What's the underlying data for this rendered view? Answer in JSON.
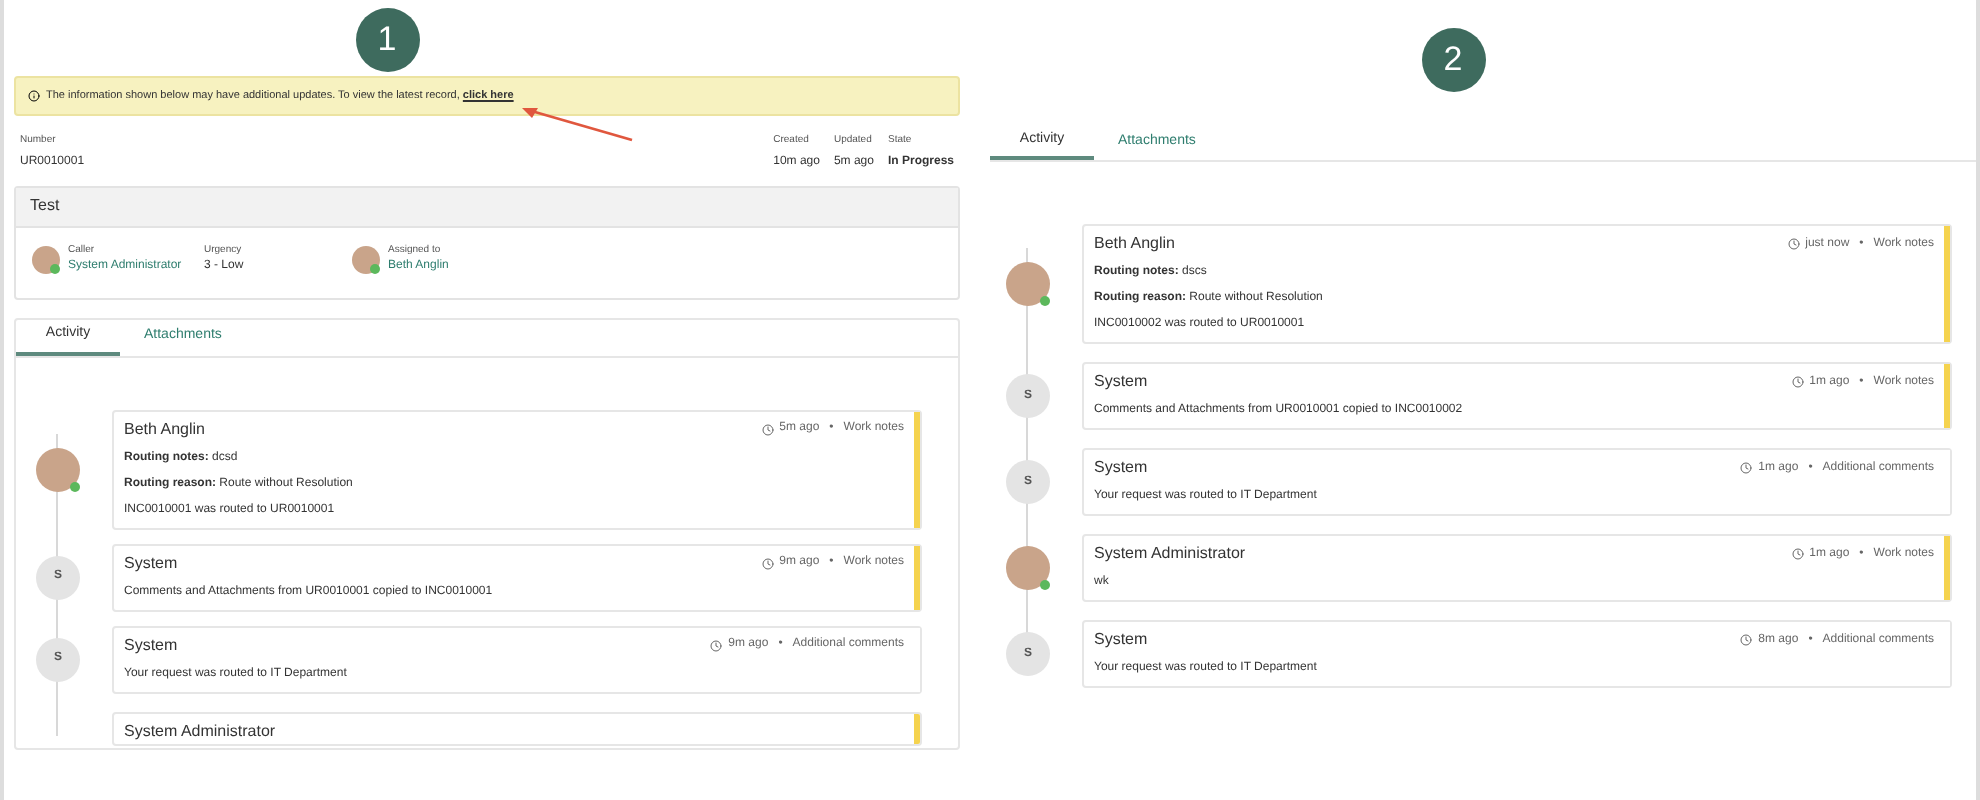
{
  "panels": [
    {
      "badge": "1",
      "banner": {
        "text": "The information shown below may have additional updates. To view the latest record,",
        "link": "click here"
      },
      "record": {
        "number_label": "Number",
        "number": "UR0010001",
        "meta": [
          {
            "label": "Created",
            "value": "10m ago",
            "bold": false
          },
          {
            "label": "Updated",
            "value": "5m ago",
            "bold": false
          },
          {
            "label": "State",
            "value": "In Progress",
            "bold": true
          }
        ]
      },
      "summary": {
        "title": "Test",
        "fields": [
          {
            "label": "Caller",
            "value": "System Administrator",
            "kind": "person"
          },
          {
            "label": "Urgency",
            "value": "3 - Low",
            "kind": "plain"
          },
          {
            "label": "Assigned to",
            "value": "Beth Anglin",
            "kind": "person"
          }
        ]
      },
      "tabs": [
        {
          "label": "Activity",
          "selected": true
        },
        {
          "label": "Attachments",
          "selected": false
        }
      ],
      "entries": [
        {
          "author": "Beth Anglin",
          "kind": "person",
          "time": "5m ago",
          "separator": "•",
          "type": "Work notes",
          "highlighted": true,
          "lines": [
            {
              "label": "Routing notes:",
              "text": "dcsd"
            },
            {
              "label": "Routing reason:",
              "text": "Route without Resolution"
            },
            {
              "text": "INC0010001 was routed to UR0010001"
            }
          ]
        },
        {
          "author": "System",
          "kind": "system",
          "initial": "S",
          "time": "9m ago",
          "separator": "•",
          "type": "Work notes",
          "highlighted": true,
          "lines": [
            {
              "text": "Comments and Attachments from UR0010001 copied to INC0010001"
            }
          ]
        },
        {
          "author": "System",
          "kind": "system",
          "initial": "S",
          "time": "9m ago",
          "separator": "•",
          "type": "Additional comments",
          "highlighted": false,
          "lines": [
            {
              "text": "Your request was routed to IT Department"
            }
          ]
        },
        {
          "author": "System Administrator",
          "highlighted": true
        }
      ]
    },
    {
      "badge": "2",
      "tabs": [
        {
          "label": "Activity",
          "selected": true
        },
        {
          "label": "Attachments",
          "selected": false
        }
      ],
      "entries": [
        {
          "author": "Beth Anglin",
          "kind": "person",
          "time": "just now",
          "separator": "•",
          "type": "Work notes",
          "highlighted": true,
          "lines": [
            {
              "label": "Routing notes:",
              "text": "dscs"
            },
            {
              "label": "Routing reason:",
              "text": "Route without Resolution"
            },
            {
              "text": "INC0010002 was routed to UR0010001"
            }
          ]
        },
        {
          "author": "System",
          "kind": "system",
          "initial": "S",
          "time": "1m ago",
          "separator": "•",
          "type": "Work notes",
          "highlighted": true,
          "lines": [
            {
              "text": "Comments and Attachments from UR0010001 copied to INC0010002"
            }
          ]
        },
        {
          "author": "System",
          "kind": "system",
          "initial": "S",
          "time": "1m ago",
          "separator": "•",
          "type": "Additional comments",
          "highlighted": false,
          "lines": [
            {
              "text": "Your request was routed to IT Department"
            }
          ]
        },
        {
          "author": "System Administrator",
          "kind": "person",
          "time": "1m ago",
          "separator": "•",
          "type": "Work notes",
          "highlighted": true,
          "lines": [
            {
              "text": "wk"
            }
          ]
        },
        {
          "author": "System",
          "kind": "system",
          "initial": "S",
          "time": "8m ago",
          "separator": "•",
          "type": "Additional comments",
          "highlighted": false,
          "lines": [
            {
              "text": "Your request was routed to IT Department"
            }
          ]
        }
      ]
    }
  ]
}
